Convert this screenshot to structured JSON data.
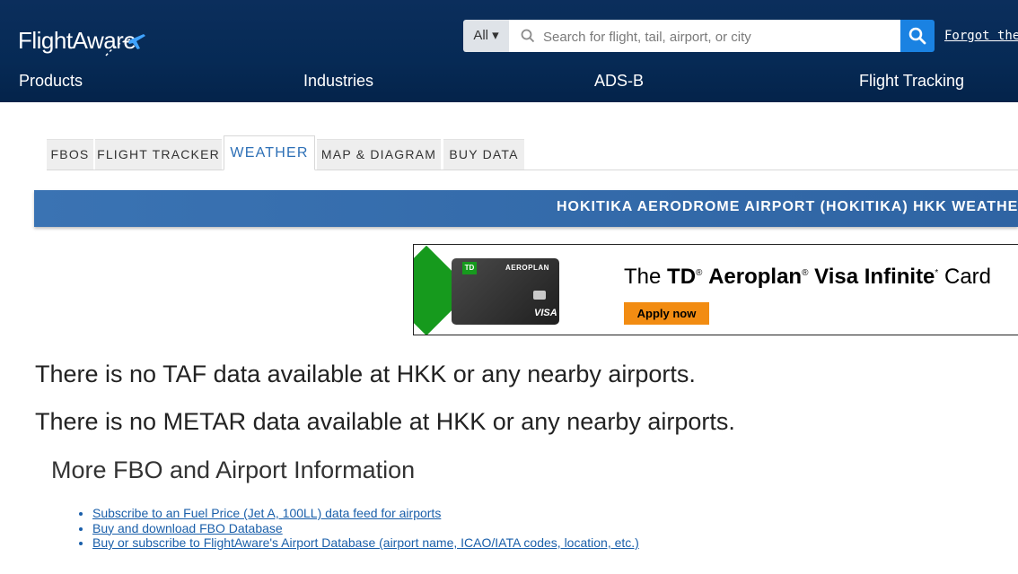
{
  "header": {
    "logo_text": "FlightAware",
    "search": {
      "scope_label": "All ▾",
      "placeholder": "Search for flight, tail, airport, or city",
      "value": ""
    },
    "forgot_link": "Forgot the f",
    "nav": [
      "Products",
      "Industries",
      "ADS-B",
      "Flight Tracking"
    ]
  },
  "tabs": [
    {
      "label": "FBOS",
      "active": false
    },
    {
      "label": "FLIGHT TRACKER",
      "active": false
    },
    {
      "label": "WEATHER",
      "active": true
    },
    {
      "label": "MAP & DIAGRAM",
      "active": false
    },
    {
      "label": "BUY DATA",
      "active": false
    }
  ],
  "banner": {
    "title": "HOKITIKA AERODROME AIRPORT (HOKITIKA) HKK WEATHER"
  },
  "ad": {
    "card_brand": "TD",
    "card_program": "AEROPLAN",
    "card_network": "VISA",
    "headline_prefix": "The ",
    "headline_td": "TD",
    "headline_aeroplan": "Aeroplan",
    "headline_visa": "Visa Infinite",
    "headline_suffix": "Card",
    "reg_mark": "®",
    "star_mark": "*",
    "cta": "Apply now"
  },
  "messages": {
    "taf": "There is no TAF data available at HKK or any nearby airports.",
    "metar": "There is no METAR data available at HKK or any nearby airports."
  },
  "more_info": {
    "title": "More FBO and Airport Information",
    "links": [
      "Subscribe to an Fuel Price (Jet A, 100LL) data feed for airports",
      "Buy and download FBO Database",
      "Buy or subscribe to FlightAware's Airport Database (airport name, ICAO/IATA codes, location, etc.)"
    ]
  },
  "colors": {
    "header_bg": "#062a55",
    "accent": "#1a82e2",
    "banner_bg": "#3a73b3",
    "active_tab": "#2c6fb6",
    "link": "#1a5faa",
    "ad_green": "#169a1d",
    "ad_orange": "#f28c12"
  }
}
